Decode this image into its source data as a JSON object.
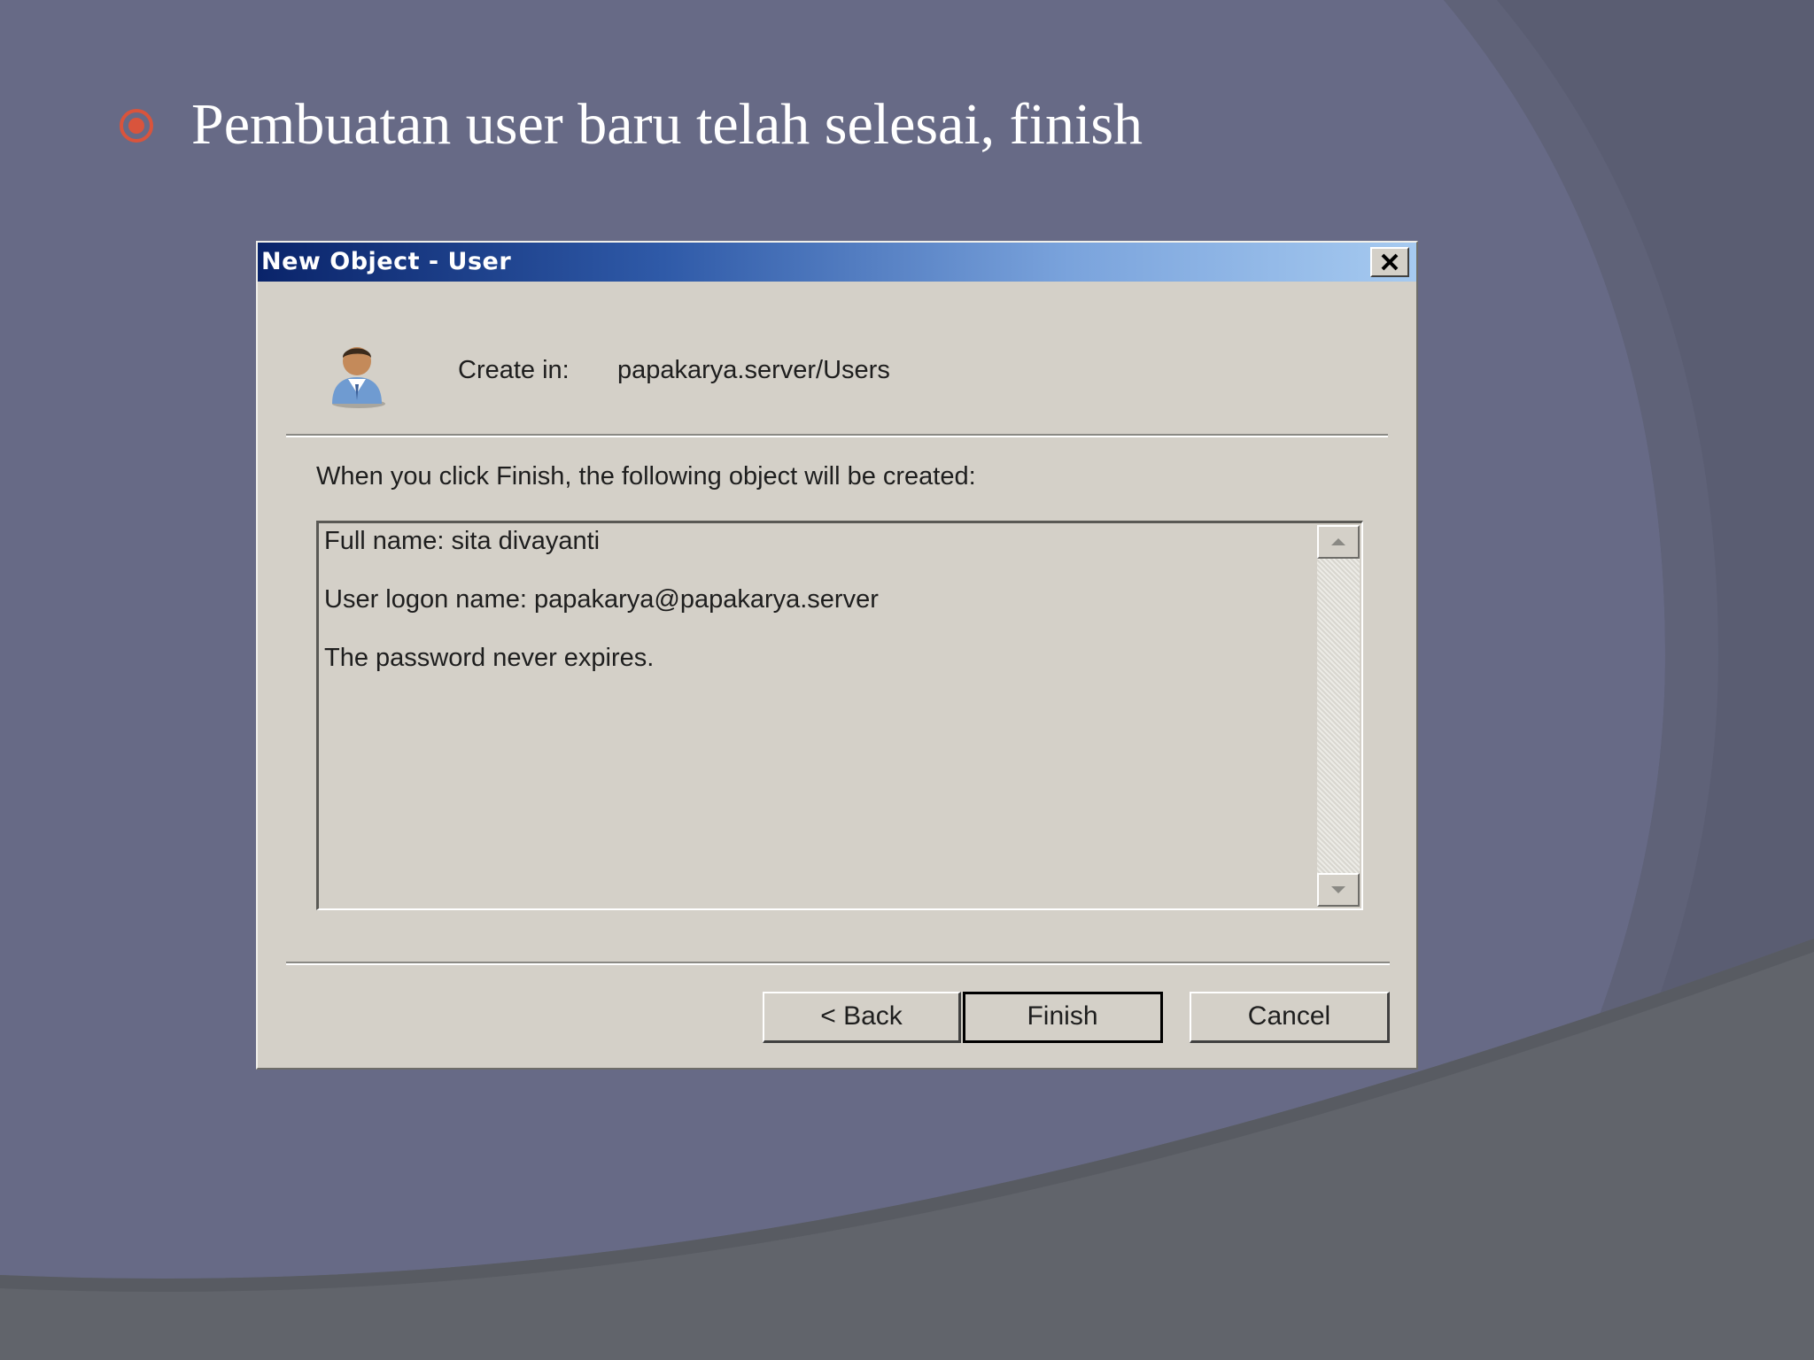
{
  "slide": {
    "bullet_text": "Pembuatan user baru telah selesai, finish",
    "colors": {
      "background": "#676a86",
      "bullet": "#d9543c",
      "title_text": "#ffffff"
    }
  },
  "dialog": {
    "title": "New Object - User",
    "close_icon": "close-icon",
    "create_in_label": "Create in:",
    "create_in_value": "papakarya.server/Users",
    "intro_text": "When you click Finish, the following object will be created:",
    "summary_lines": [
      "Full name: sita divayanti",
      "User logon name: papakarya@papakarya.server",
      "The password never expires."
    ],
    "buttons": {
      "back": "< Back",
      "finish": "Finish",
      "cancel": "Cancel"
    },
    "colors": {
      "titlebar_start": "#0a246a",
      "titlebar_end": "#a6caf0",
      "face": "#d4d0c8"
    }
  }
}
